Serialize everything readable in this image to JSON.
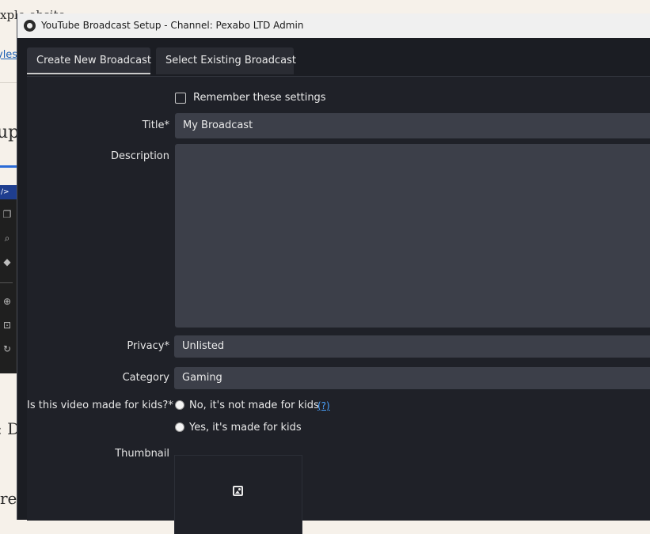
{
  "background_page": {
    "text_top": "xplo         ebsite",
    "link_partial": "yles",
    "heading_partial": "upo",
    "ide_tab": "/> Ac",
    "text_d": ": D",
    "text_bottom": "re"
  },
  "window": {
    "title": "YouTube Broadcast Setup - Channel: Pexabo LTD Admin"
  },
  "tabs": [
    {
      "label": "Create New Broadcast",
      "active": true
    },
    {
      "label": "Select Existing Broadcast",
      "active": false
    }
  ],
  "form": {
    "remember_label": "Remember these settings",
    "remember_checked": false,
    "title_label": "Title*",
    "title_value": "My Broadcast",
    "description_label": "Description",
    "description_value": "",
    "privacy_label": "Privacy*",
    "privacy_value": "Unlisted",
    "category_label": "Category",
    "category_value": "Gaming",
    "kids_label": "Is this video made for kids?*",
    "kids_option_no": "No, it's not made for kids",
    "kids_help": "(?)",
    "kids_option_yes": "Yes, it's made for kids",
    "thumbnail_label": "Thumbnail"
  },
  "colors": {
    "window_bg": "#1b1d23",
    "field_bg": "#3c3f49",
    "link": "#4aa3ff"
  },
  "icons": {
    "app": "obs-icon",
    "thumbnail": "image-icon"
  }
}
